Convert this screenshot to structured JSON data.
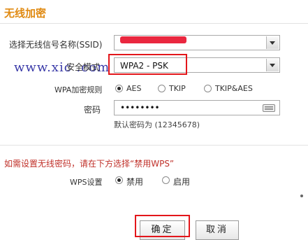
{
  "section": {
    "title": "无线加密"
  },
  "ssid": {
    "label": "选择无线信号名称(SSID)",
    "value": ""
  },
  "security_mode": {
    "label": "安全模式",
    "value": "WPA2 - PSK"
  },
  "watermark": "www.xic    .com",
  "wpa_rule": {
    "label": "WPA加密规则",
    "options": [
      "AES",
      "TKIP",
      "TKIP&AES"
    ],
    "selected": "AES"
  },
  "password": {
    "label": "密码",
    "value": "••••••••",
    "hint": "默认密码为 (12345678)"
  },
  "warning": "如需设置无线密码，请在下方选择“禁用WPS”",
  "wps": {
    "label": "WPS设置",
    "options": [
      "禁用",
      "启用"
    ],
    "selected": "禁用"
  },
  "buttons": {
    "confirm": "确定",
    "cancel": "取消"
  },
  "colors": {
    "title": "#e08a12",
    "highlight": "#e3161b",
    "warning": "#c0312a",
    "watermark": "#3a3aa8"
  }
}
